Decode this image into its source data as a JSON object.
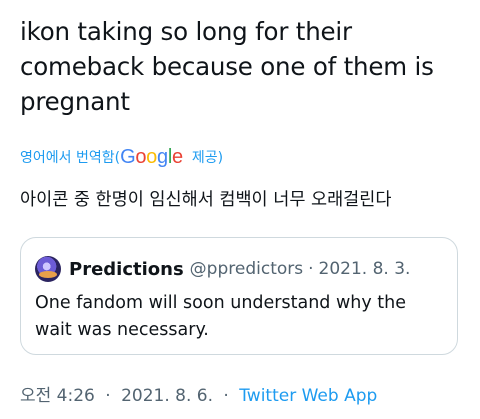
{
  "tweet": {
    "text": "ikon taking so long for their comeback because one of them is pregnant"
  },
  "translation": {
    "prefix": "영어에서 번역함(",
    "google_letters": [
      "G",
      "o",
      "o",
      "g",
      "l",
      "e"
    ],
    "provided": "제공)",
    "text": "아이콘 중 한명이 임신해서 컴백이 너무 오래걸린다"
  },
  "quote": {
    "name": "Predictions",
    "handle": "@ppredictors",
    "separator": "·",
    "date": "2021. 8. 3.",
    "text": "One fandom will soon understand why the wait was necessary.",
    "avatar_icon": "galaxy-avatar"
  },
  "meta": {
    "time": "오전 4:26",
    "separator": "·",
    "date": "2021. 8. 6.",
    "source": "Twitter Web App"
  },
  "colors": {
    "link": "#1d9bf0",
    "secondary": "#536471",
    "border": "#cfd9de",
    "text": "#0f1419"
  }
}
